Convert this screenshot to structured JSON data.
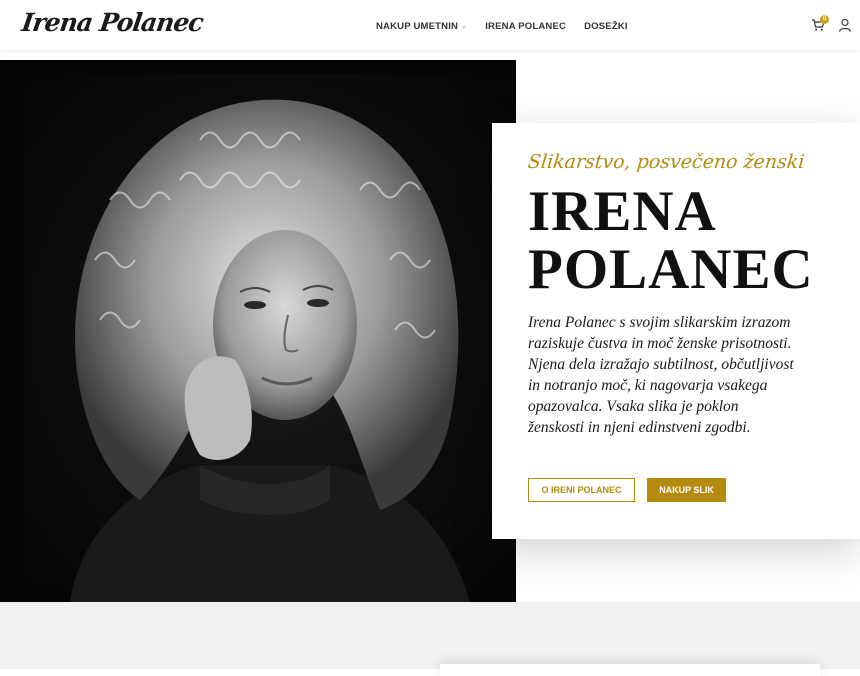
{
  "brand": {
    "logo_text": "Irena Polanec"
  },
  "nav": {
    "items": [
      {
        "label": "NAKUP UMETNIN",
        "has_dropdown": true
      },
      {
        "label": "IRENA POLANEC",
        "has_dropdown": false
      },
      {
        "label": "DOSEŽKI",
        "has_dropdown": false
      }
    ]
  },
  "header_icons": {
    "cart": {
      "icon": "cart-icon",
      "count": "0",
      "badge_color": "#c9a227"
    },
    "account": {
      "icon": "user-icon"
    }
  },
  "hero": {
    "image": {
      "subject": "portrait-photo",
      "icon": "portrait-image"
    },
    "tagline": "Slikarstvo, posvečeno ženski",
    "name_line1": "IRENA",
    "name_line2": "POLANEC",
    "description": "Irena Polanec s svojim slikarskim izrazom raziskuje čustva in moč ženske prisotnosti. Njena dela izražajo subtilnost, občutljivost in notranjo moč, ki nagovarja vsakega opazovalca. Vsaka slika je poklon ženskosti in njeni edinstveni zgodbi.",
    "buttons": {
      "about_label": "O IRENI POLANEC",
      "shop_label": "NAKUP SLIK"
    }
  },
  "colors": {
    "accent": "#b58b0d",
    "text": "#111111",
    "photo_bg": "#050505",
    "band": "#f1f1f1"
  }
}
